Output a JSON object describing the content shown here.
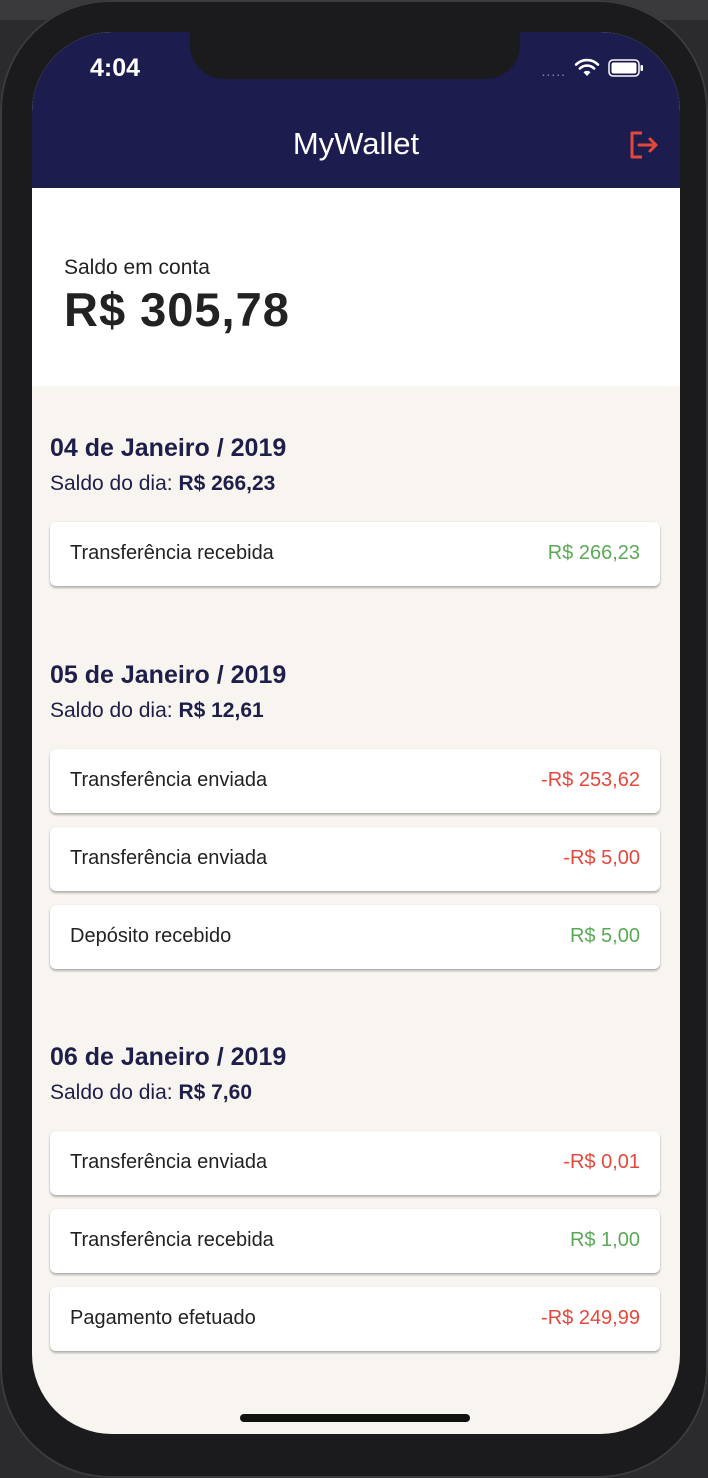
{
  "status_bar": {
    "time": "4:04",
    "signal": "....."
  },
  "header": {
    "title": "MyWallet",
    "logout_icon": "logout-icon",
    "accent": "#e4473b",
    "background": "#1c1c4f"
  },
  "account": {
    "label": "Saldo em conta",
    "value": "R$ 305,78"
  },
  "days": [
    {
      "date": "04 de Janeiro / 2019",
      "balance_label": "Saldo do dia:",
      "balance_value": "R$ 266,23",
      "transactions": [
        {
          "label": "Transferência recebida",
          "amount": "R$ 266,23",
          "type": "credit"
        }
      ]
    },
    {
      "date": "05 de Janeiro / 2019",
      "balance_label": "Saldo do dia:",
      "balance_value": "R$ 12,61",
      "transactions": [
        {
          "label": "Transferência enviada",
          "amount": "-R$ 253,62",
          "type": "debit"
        },
        {
          "label": "Transferência enviada",
          "amount": "-R$ 5,00",
          "type": "debit"
        },
        {
          "label": "Depósito recebido",
          "amount": "R$ 5,00",
          "type": "credit"
        }
      ]
    },
    {
      "date": "06 de Janeiro / 2019",
      "balance_label": "Saldo do dia:",
      "balance_value": "R$ 7,60",
      "transactions": [
        {
          "label": "Transferência enviada",
          "amount": "-R$ 0,01",
          "type": "debit"
        },
        {
          "label": "Transferência recebida",
          "amount": "R$ 1,00",
          "type": "credit"
        },
        {
          "label": "Pagamento efetuado",
          "amount": "-R$ 249,99",
          "type": "debit"
        }
      ]
    }
  ],
  "colors": {
    "credit": "#5aaa55",
    "debit": "#e4473b",
    "page_background": "#f8f5f0"
  }
}
